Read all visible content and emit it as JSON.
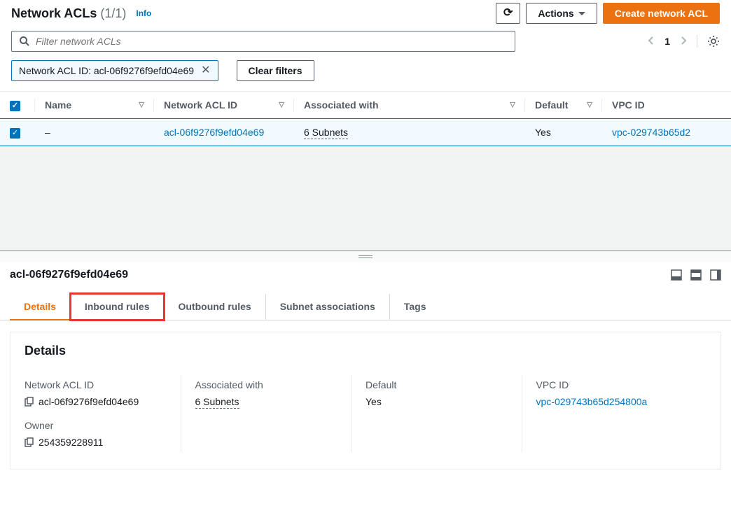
{
  "header": {
    "title": "Network ACLs",
    "count": "(1/1)",
    "info": "Info"
  },
  "toolbar": {
    "actions_label": "Actions",
    "create_label": "Create network ACL"
  },
  "search": {
    "placeholder": "Filter network ACLs"
  },
  "pagination": {
    "page": "1"
  },
  "filter_chip": {
    "key": "Network ACL ID:",
    "value": "acl-06f9276f9efd04e69"
  },
  "buttons": {
    "clear_filters": "Clear filters"
  },
  "table": {
    "columns": {
      "name": "Name",
      "acl_id": "Network ACL ID",
      "associated": "Associated with",
      "default": "Default",
      "vpc_id": "VPC ID"
    },
    "row": {
      "name": "–",
      "acl_id": "acl-06f9276f9efd04e69",
      "associated": "6 Subnets",
      "default": "Yes",
      "vpc_id": "vpc-029743b65d2"
    }
  },
  "detail": {
    "title": "acl-06f9276f9efd04e69",
    "tabs": {
      "details": "Details",
      "inbound": "Inbound rules",
      "outbound": "Outbound rules",
      "subnet": "Subnet associations",
      "tags": "Tags"
    },
    "panel": {
      "heading": "Details",
      "labels": {
        "acl_id": "Network ACL ID",
        "associated": "Associated with",
        "default": "Default",
        "vpc_id": "VPC ID",
        "owner": "Owner"
      },
      "values": {
        "acl_id": "acl-06f9276f9efd04e69",
        "associated": "6 Subnets",
        "default": "Yes",
        "vpc_id": "vpc-029743b65d254800a",
        "owner": "254359228911"
      }
    }
  }
}
